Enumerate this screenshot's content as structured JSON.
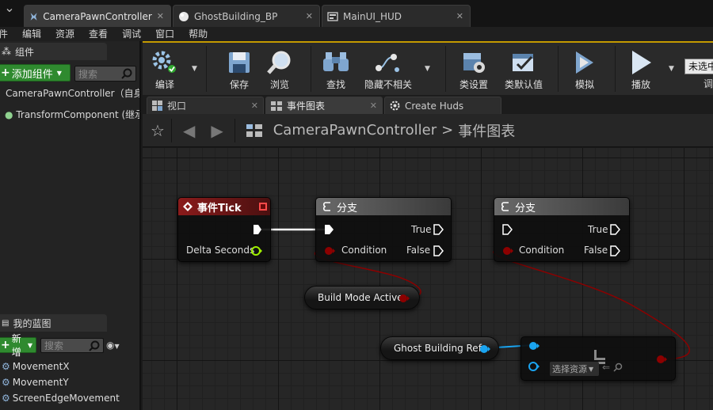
{
  "tabs": [
    {
      "label": "CameraPawnController",
      "active": true
    },
    {
      "label": "GhostBuilding_BP",
      "active": false
    },
    {
      "label": "MainUI_HUD",
      "active": false
    }
  ],
  "menu": [
    "文件",
    "编辑",
    "资源",
    "查看",
    "调试",
    "窗口",
    "帮助"
  ],
  "components_panel": {
    "title": "组件",
    "add_button": "添加组件",
    "search_placeholder": "搜索",
    "rows": [
      "CameraPawnController（自身",
      "TransformComponent (继承"
    ]
  },
  "my_blueprint": {
    "title": "我的蓝图",
    "new_button": "新增",
    "search_placeholder": "搜索",
    "variables": [
      "MovementX",
      "MovementY",
      "ScreenEdgeMovement"
    ]
  },
  "toolbar": {
    "compile": "编译",
    "save": "保存",
    "browse": "浏览",
    "find": "查找",
    "hide_unrelated": "隐藏不相关",
    "class_settings": "类设置",
    "class_defaults": "类默认值",
    "simulate": "模拟",
    "play": "播放",
    "debug_filter": "未选中",
    "debug_label": "调"
  },
  "graph_tabs": [
    "视口",
    "事件图表",
    "Create Huds"
  ],
  "breadcrumb": {
    "root": "CameraPawnController",
    "sep": ">",
    "current": "事件图表"
  },
  "nodes": {
    "event_tick": {
      "title": "事件Tick",
      "pin": "Delta Seconds"
    },
    "branch1": {
      "title": "分支",
      "cond": "Condition",
      "true": "True",
      "false": "False"
    },
    "branch2": {
      "title": "分支",
      "cond": "Condition",
      "true": "True",
      "false": "False"
    },
    "build_mode": {
      "label": "Build Mode Active"
    },
    "ghost_ref": {
      "label": "Ghost Building Ref"
    },
    "is_valid": {
      "asset_label": "选择资源"
    }
  },
  "colors": {
    "accent": "#c49a00",
    "exec": "#ffffff",
    "bool_pin": "#8c0000",
    "object_pin": "#1aa4f0",
    "float_pin": "#9ff000",
    "add_green": "#2f8a2f"
  }
}
